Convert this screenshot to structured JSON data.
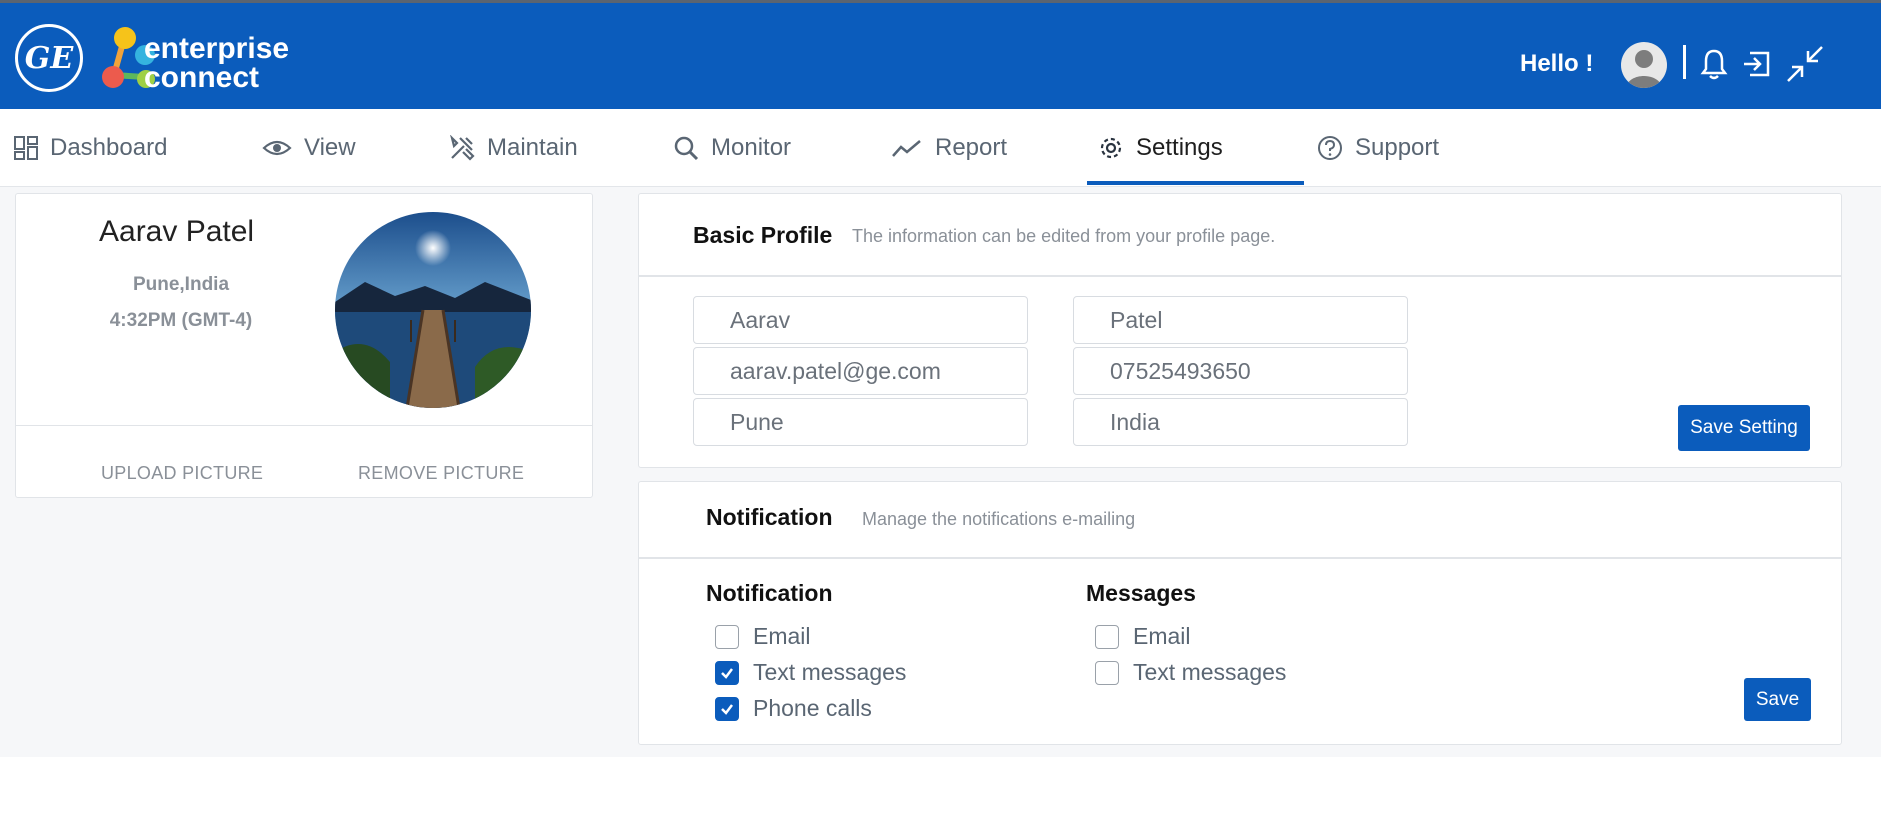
{
  "header": {
    "ge_logo_text": "GE",
    "brand_line1": "enterprise",
    "brand_line2": "connect",
    "greeting": "Hello !"
  },
  "nav": {
    "items": [
      {
        "label": "Dashboard",
        "icon": "dashboard-icon"
      },
      {
        "label": "View",
        "icon": "eye-icon"
      },
      {
        "label": "Maintain",
        "icon": "tools-icon"
      },
      {
        "label": "Monitor",
        "icon": "search-icon"
      },
      {
        "label": "Report",
        "icon": "chart-line-icon"
      },
      {
        "label": "Settings",
        "icon": "gear-icon",
        "active": true
      },
      {
        "label": "Support",
        "icon": "help-icon"
      }
    ]
  },
  "profile": {
    "name": "Aarav Patel",
    "location": "Pune,India",
    "time": "4:32PM (GMT-4)",
    "upload_label": "UPLOAD PICTURE",
    "remove_label": "REMOVE PICTURE"
  },
  "basic_profile": {
    "title": "Basic Profile",
    "subtitle": "The information can be edited from your profile page.",
    "first_name": "Aarav",
    "last_name": "Patel",
    "email": "aarav.patel@ge.com",
    "phone": "07525493650",
    "city": "Pune",
    "country": "India",
    "save_label": "Save Setting"
  },
  "notification": {
    "title": "Notification",
    "subtitle": "Manage the notifications e-mailing",
    "col1_title": "Notification",
    "col1_options": [
      {
        "label": "Email",
        "checked": false
      },
      {
        "label": "Text messages",
        "checked": true
      },
      {
        "label": "Phone calls",
        "checked": true
      }
    ],
    "col2_title": "Messages",
    "col2_options": [
      {
        "label": "Email",
        "checked": false
      },
      {
        "label": "Text messages",
        "checked": false
      }
    ],
    "save_label": "Save"
  },
  "colors": {
    "brand_blue": "#0b5cbc",
    "muted_text": "#8a9098"
  }
}
